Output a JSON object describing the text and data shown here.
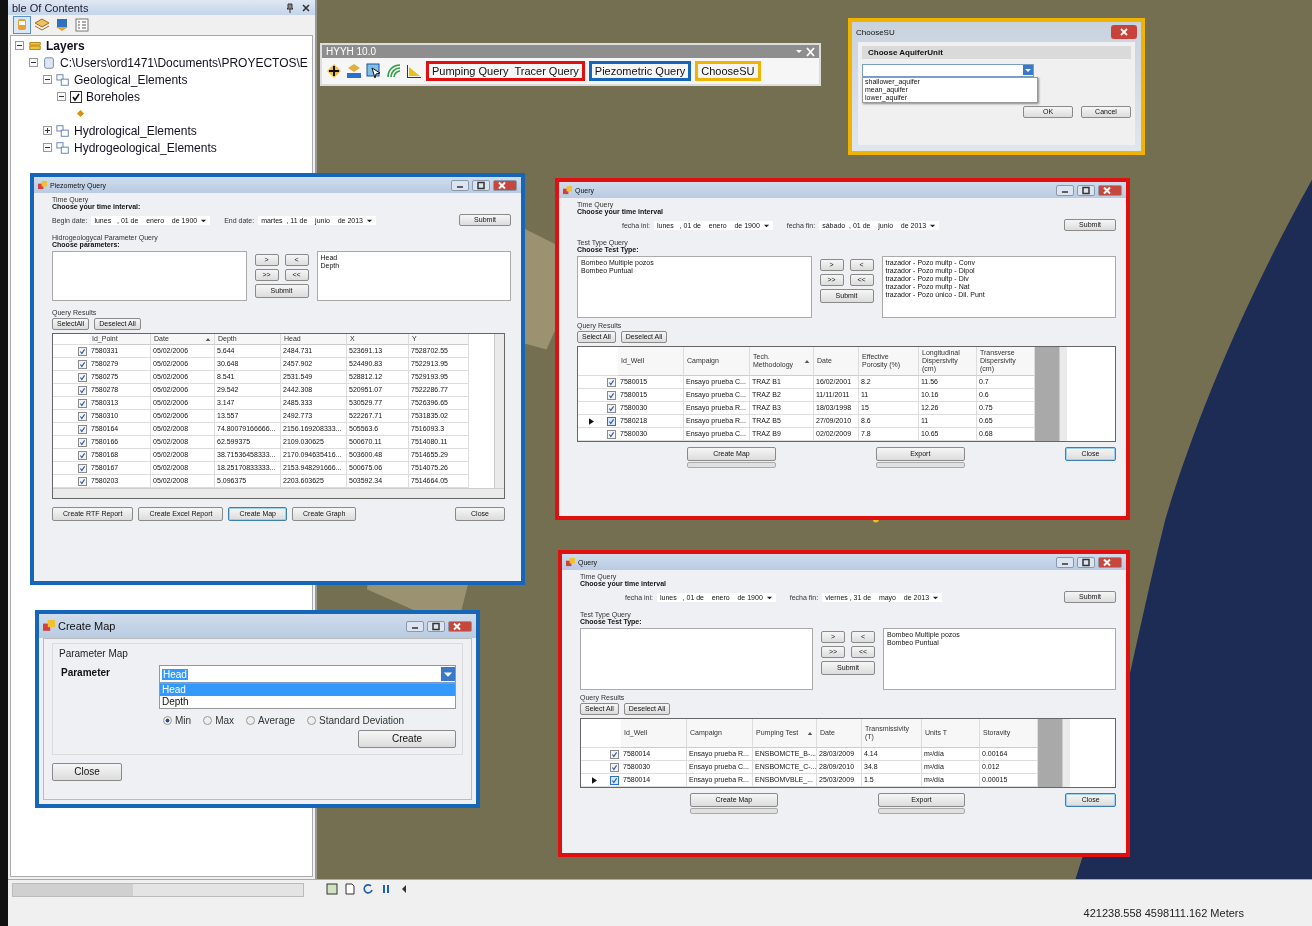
{
  "toc": {
    "title": "ble Of Contents",
    "tree": [
      {
        "label": "Layers",
        "kind": "root",
        "expanded": true,
        "children": [
          {
            "label": "C:\\Users\\ord1471\\Documents\\PROYECTOS\\E",
            "kind": "database",
            "expanded": true,
            "children": [
              {
                "label": "Geological_Elements",
                "kind": "group",
                "expanded": true,
                "children": [
                  {
                    "label": "Boreholes",
                    "kind": "layer",
                    "expanded": true,
                    "checked": true
                  }
                ]
              },
              {
                "label": "Hydrological_Elements",
                "kind": "group",
                "expanded": false
              },
              {
                "label": "Hydrogeological_Elements",
                "kind": "group",
                "expanded": true
              }
            ]
          }
        ]
      }
    ]
  },
  "toolbar": {
    "title": "HYYH 10.0",
    "groups": [
      {
        "color": "#e01010",
        "buttons": [
          "Pumping Query",
          "Tracer Query"
        ]
      },
      {
        "color": "#1565b8",
        "buttons": [
          "Piezometric Query"
        ]
      },
      {
        "color": "#f0b400",
        "buttons": [
          "ChooseSU"
        ]
      }
    ]
  },
  "choose_su": {
    "title": "ChooseSU",
    "color": "#f0b400",
    "heading": "Choose AquiferUnit",
    "options": [
      "shallower_aquifer",
      "mean_aquifer",
      "lower_aquifer"
    ],
    "buttons": [
      "OK",
      "Cancel"
    ]
  },
  "piezometry": {
    "title": "Piezometry Query",
    "color": "#1565b8",
    "time_section": "Time Query",
    "time_heading": "Choose your time interval:",
    "begin_label": "Begin date:",
    "begin_date": "lunes   , 01 de    enero    de 1900",
    "end_label": "End date:",
    "end_date": "martes  , 11 de    junio    de 2013",
    "time_submit": "Submit",
    "param_section": "Hidrogeologycal Parameter Query",
    "param_heading": "Choose parameters:",
    "chosen": [
      "Head",
      "Depth"
    ],
    "move_buttons": [
      ">",
      "<",
      ">>",
      "<<"
    ],
    "list_submit": "Submit",
    "results_label": "Query Results",
    "select_buttons": [
      "SelectAll",
      "Deselect All"
    ],
    "table": {
      "columns": [
        {
          "label": "Id_Point",
          "sorted": false
        },
        {
          "label": "Date",
          "sorted": true
        },
        {
          "label": "Depth",
          "sorted": false
        },
        {
          "label": "Head",
          "sorted": false
        },
        {
          "label": "X",
          "sorted": false
        },
        {
          "label": "Y",
          "sorted": false
        }
      ],
      "rows": [
        {
          "checked": true,
          "selected": false,
          "cells": [
            "7580331",
            "05/02/2006",
            "5.644",
            "2484.731",
            "523691.13",
            "7528702.55"
          ]
        },
        {
          "checked": true,
          "selected": false,
          "cells": [
            "7580279",
            "05/02/2006",
            "30.648",
            "2457.902",
            "524490.83",
            "7522913.95"
          ]
        },
        {
          "checked": true,
          "selected": false,
          "cells": [
            "7580275",
            "05/02/2006",
            "8.541",
            "2531.549",
            "528812.12",
            "7529193.95"
          ]
        },
        {
          "checked": true,
          "selected": false,
          "cells": [
            "7580278",
            "05/02/2006",
            "29.542",
            "2442.308",
            "520951.07",
            "7522286.77"
          ]
        },
        {
          "checked": true,
          "selected": false,
          "cells": [
            "7580313",
            "05/02/2006",
            "3.147",
            "2485.333",
            "530529.77",
            "7526396.65"
          ]
        },
        {
          "checked": true,
          "selected": false,
          "cells": [
            "7580310",
            "05/02/2006",
            "13.557",
            "2492.773",
            "522267.71",
            "7531835.02"
          ]
        },
        {
          "checked": true,
          "selected": false,
          "cells": [
            "7580164",
            "05/02/2008",
            "74.80079166666...",
            "2156.169208333...",
            "505563.6",
            "7516093.3"
          ]
        },
        {
          "checked": true,
          "selected": false,
          "cells": [
            "7580166",
            "05/02/2008",
            "62.599375",
            "2109.030625",
            "500670.11",
            "7514080.11"
          ]
        },
        {
          "checked": true,
          "selected": false,
          "cells": [
            "7580168",
            "05/02/2008",
            "38.71536458333...",
            "2170.094635416...",
            "503600.48",
            "7514655.29"
          ]
        },
        {
          "checked": true,
          "selected": false,
          "cells": [
            "7580167",
            "05/02/2008",
            "18.25170833333...",
            "2153.948291666...",
            "500675.06",
            "7514075.26"
          ]
        },
        {
          "checked": true,
          "selected": false,
          "cells": [
            "7580203",
            "05/02/2008",
            "5.096375",
            "2203.603625",
            "503592.34",
            "7514664.05"
          ]
        }
      ]
    },
    "buttons": [
      {
        "label": "Create RTF Report",
        "focused": false
      },
      {
        "label": "Create Excel Report",
        "focused": false
      },
      {
        "label": "Create Map",
        "focused": true
      },
      {
        "label": "Create Graph",
        "focused": false
      },
      {
        "label": "Close",
        "focused": false
      }
    ]
  },
  "query_windows": [
    {
      "title": "Query",
      "color": "#e01010",
      "time_section": "Time Query",
      "time_heading": "Choose your time interval",
      "begin_label": "fecha ini:",
      "begin_date": "lunes   , 01 de    enero    de 1900",
      "end_label": "fecha fin:",
      "end_date": "sábado  , 01 de    junio    de 2013",
      "time_submit": "Submit",
      "type_section": "Test Type Query",
      "type_heading": "Choose Test Type:",
      "available": [
        "Bombeo Multiple pozos",
        "Bombeo Puntual"
      ],
      "chosen": [
        "trazador - Pozo multp - Conv",
        "trazador - Pozo multp - Dipol",
        "trazador - Pozo multp - Div",
        "trazador - Pozo multp - Nat",
        "trazador - Pozo único - Dil. Punt"
      ],
      "move_buttons": [
        ">",
        "<",
        ">>",
        "<<"
      ],
      "list_submit": "Submit",
      "results_label": "Query Results",
      "select_buttons": [
        "Select All",
        "Deselect All"
      ],
      "table": {
        "columns": [
          {
            "label": "Id_Well",
            "sorted": false
          },
          {
            "label": "Campaign",
            "sorted": false
          },
          {
            "label": "Tech. Methodology",
            "sorted": true
          },
          {
            "label": "Date",
            "sorted": false
          },
          {
            "label": "Effective Porosity (%)",
            "sorted": false
          },
          {
            "label": "Longitudinal Dispersivity (cm)",
            "sorted": false
          },
          {
            "label": "Transverse Dispersivity (cm)",
            "sorted": false
          }
        ],
        "rows": [
          {
            "checked": true,
            "selected": false,
            "cells": [
              "7580015",
              "Ensayo prueba C...",
              "TRAZ B1",
              "16/02/2001",
              "8.2",
              "11.56",
              "0.7"
            ]
          },
          {
            "checked": true,
            "selected": false,
            "cells": [
              "7580015",
              "Ensayo prueba C...",
              "TRAZ B2",
              "11/11/2011",
              "11",
              "10.16",
              "0.6"
            ]
          },
          {
            "checked": true,
            "selected": false,
            "cells": [
              "7580030",
              "Ensayo prueba R...",
              "TRAZ B3",
              "18/03/1998",
              "15",
              "12.26",
              "0.75"
            ]
          },
          {
            "checked": true,
            "selected": true,
            "cells": [
              "7580218",
              "Ensayo prueba R...",
              "TRAZ B5",
              "27/09/2010",
              "8.6",
              "11",
              "0.65"
            ]
          },
          {
            "checked": true,
            "selected": false,
            "cells": [
              "7580030",
              "Ensayo prueba C...",
              "TRAZ B9",
              "02/02/2009",
              "7.8",
              "10.65",
              "0.68"
            ]
          }
        ]
      },
      "actions": [
        {
          "label": "Create Map"
        },
        {
          "label": "Export"
        }
      ],
      "close": "Close"
    },
    {
      "title": "Query",
      "color": "#e01010",
      "time_section": "Time Query",
      "time_heading": "Choose your time interval",
      "begin_label": "fecha ini:",
      "begin_date": "lunes   , 01 de    enero    de 1900",
      "end_label": "fecha fin:",
      "end_date": "viernes , 31 de    mayo    de 2013",
      "time_submit": "Submit",
      "type_section": "Test Type Query",
      "type_heading": "Choose Test Type:",
      "chosen": [
        "Bombeo Multiple pozos",
        "Bombeo Puntual"
      ],
      "move_buttons": [
        ">",
        "<",
        ">>",
        "<<"
      ],
      "list_submit": "Submit",
      "results_label": "Query Results",
      "select_buttons": [
        "Select All",
        "Deselect All"
      ],
      "table": {
        "columns": [
          {
            "label": "Id_Well",
            "sorted": false
          },
          {
            "label": "Campaign",
            "sorted": false
          },
          {
            "label": "Pumping Test",
            "sorted": true
          },
          {
            "label": "Date",
            "sorted": false
          },
          {
            "label": "Transmissivity (T)",
            "sorted": false
          },
          {
            "label": "Units T",
            "sorted": false
          },
          {
            "label": "Storavity",
            "sorted": false
          }
        ],
        "rows": [
          {
            "checked": true,
            "selected": false,
            "cells": [
              "7580014",
              "Ensayo prueba R...",
              "ENSBOMCTE_B-...",
              "28/03/2009",
              "4.14",
              "m²/día",
              "0.00164"
            ]
          },
          {
            "checked": true,
            "selected": false,
            "cells": [
              "7580030",
              "Ensayo prueba C...",
              "ENSBOMCTE_C-...",
              "28/09/2010",
              "34.8",
              "m²/día",
              "0.012"
            ]
          },
          {
            "checked": true,
            "selected": true,
            "cells": [
              "7580014",
              "Ensayo prueba R...",
              "ENSBOMVBLE_...",
              "25/03/2009",
              "1.5",
              "m²/día",
              "0.00015"
            ]
          }
        ]
      },
      "actions": [
        {
          "label": "Create Map"
        },
        {
          "label": "Export"
        }
      ],
      "close": "Close"
    }
  ],
  "create_map": {
    "title": "Create Map",
    "color": "#1565b8",
    "section": "Parameter Map",
    "label": "Parameter",
    "value": "Head",
    "options": [
      {
        "label": "Head",
        "selected": true
      },
      {
        "label": "Depth",
        "selected": false
      }
    ],
    "statistics": [
      {
        "label": "Min",
        "selected": true
      },
      {
        "label": "Max",
        "selected": false
      },
      {
        "label": "Average",
        "selected": false
      },
      {
        "label": "Standard Deviation",
        "selected": false
      }
    ],
    "create": "Create",
    "close": "Close"
  },
  "status_bar": {
    "coordinates": "421238.558  4598111.162 Meters"
  }
}
